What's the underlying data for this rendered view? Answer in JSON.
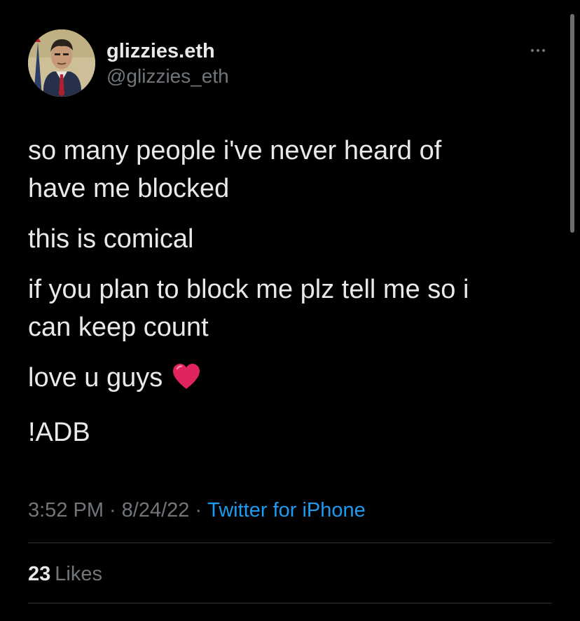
{
  "author": {
    "display_name": "glizzies.eth",
    "handle": "@glizzies_eth"
  },
  "tweet": {
    "paragraphs": [
      "so many people i've never heard of\nhave me blocked",
      "this is comical",
      "if you plan to block me plz tell me so i\ncan keep count",
      "love u guys",
      "!ADB"
    ],
    "emoji": "heart-emoji"
  },
  "meta": {
    "time": "3:52 PM",
    "date": "8/24/22",
    "separator": "·",
    "source": "Twitter for iPhone"
  },
  "stats": {
    "likes_count": "23",
    "likes_label": "Likes"
  },
  "icons": {
    "more": "more-icon"
  },
  "colors": {
    "background": "#000000",
    "text": "#e7e9ea",
    "secondary": "#71767b",
    "link": "#1d9bf0",
    "divider": "#2f3336",
    "heart": "#e0245e"
  }
}
